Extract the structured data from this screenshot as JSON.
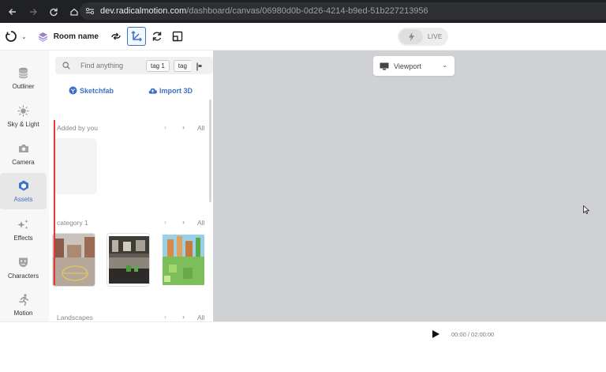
{
  "browser": {
    "url_host": "dev.radicalmotion.com",
    "url_path": "/dashboard/canvas/06980d0b-0d26-4214-b9ed-51b227213956",
    "icons": [
      "back-arrow-icon",
      "forward-arrow-icon",
      "reload-icon",
      "home-icon",
      "site-info-icon"
    ]
  },
  "toolbar": {
    "room_name": "Room name",
    "live_label": "LIVE",
    "tools": [
      "connect-icon",
      "transform-icon",
      "rotate-icon",
      "scale-icon"
    ],
    "accent": "#3e71c9"
  },
  "leftnav": {
    "items": [
      {
        "label": "Outliner",
        "icon": "database-icon"
      },
      {
        "label": "Sky & Light",
        "icon": "sun-icon"
      },
      {
        "label": "Camera",
        "icon": "camera-icon"
      },
      {
        "label": "Assets",
        "icon": "assets-icon",
        "active": true
      },
      {
        "label": "Effects",
        "icon": "sparkle-icon"
      },
      {
        "label": "Characters",
        "icon": "mask-icon"
      },
      {
        "label": "Motion",
        "icon": "running-icon"
      }
    ]
  },
  "assets": {
    "search_placeholder": "Find anything",
    "tags": [
      "tag 1",
      "tag"
    ],
    "sketchfab_label": "Sketchfab",
    "import_label": "Import 3D",
    "sections": [
      {
        "title": "Added by you",
        "all": "All"
      },
      {
        "title": "category 1",
        "all": "All"
      },
      {
        "title": "Landscapes",
        "all": "All"
      }
    ],
    "prev_arrow": "‹",
    "next_arrow": "›"
  },
  "viewport": {
    "select_label": "Viewport",
    "background": "#cfd1d4"
  },
  "timeline": {
    "time": "00:00 / 02:00:00"
  }
}
